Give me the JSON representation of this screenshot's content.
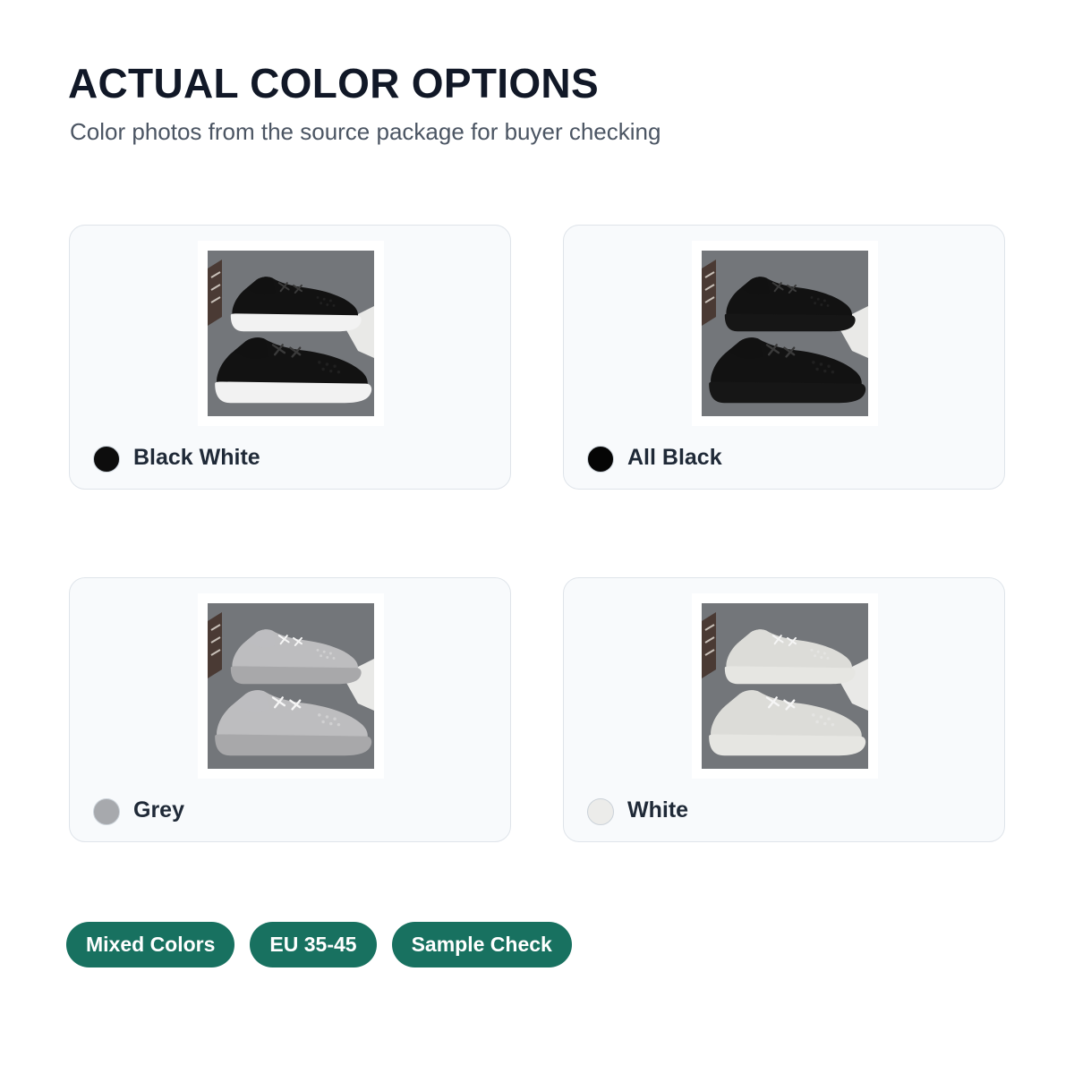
{
  "header": {
    "title": "ACTUAL COLOR OPTIONS",
    "subtitle": "Color photos from the source package for buyer checking"
  },
  "colors": [
    {
      "name": "Black White",
      "swatch": "#0d0d0d",
      "upper": "#121212",
      "sole": "#f2f2f2",
      "icon": "sneaker-black-white-icon"
    },
    {
      "name": "All Black",
      "swatch": "#050505",
      "upper": "#121212",
      "sole": "#161616",
      "icon": "sneaker-all-black-icon"
    },
    {
      "name": "Grey",
      "swatch": "#a7a9ad",
      "upper": "#bdbdbf",
      "sole": "#a8a8aa",
      "icon": "sneaker-grey-icon"
    },
    {
      "name": "White",
      "swatch": "#ececea",
      "upper": "#dcdcd8",
      "sole": "#e6e6e2",
      "icon": "sneaker-white-icon"
    }
  ],
  "tags": [
    "Mixed Colors",
    "EU 35-45",
    "Sample Check"
  ],
  "theme": {
    "tag_bg": "#187160",
    "card_bg": "#f8fafc",
    "title_color": "#111827"
  }
}
